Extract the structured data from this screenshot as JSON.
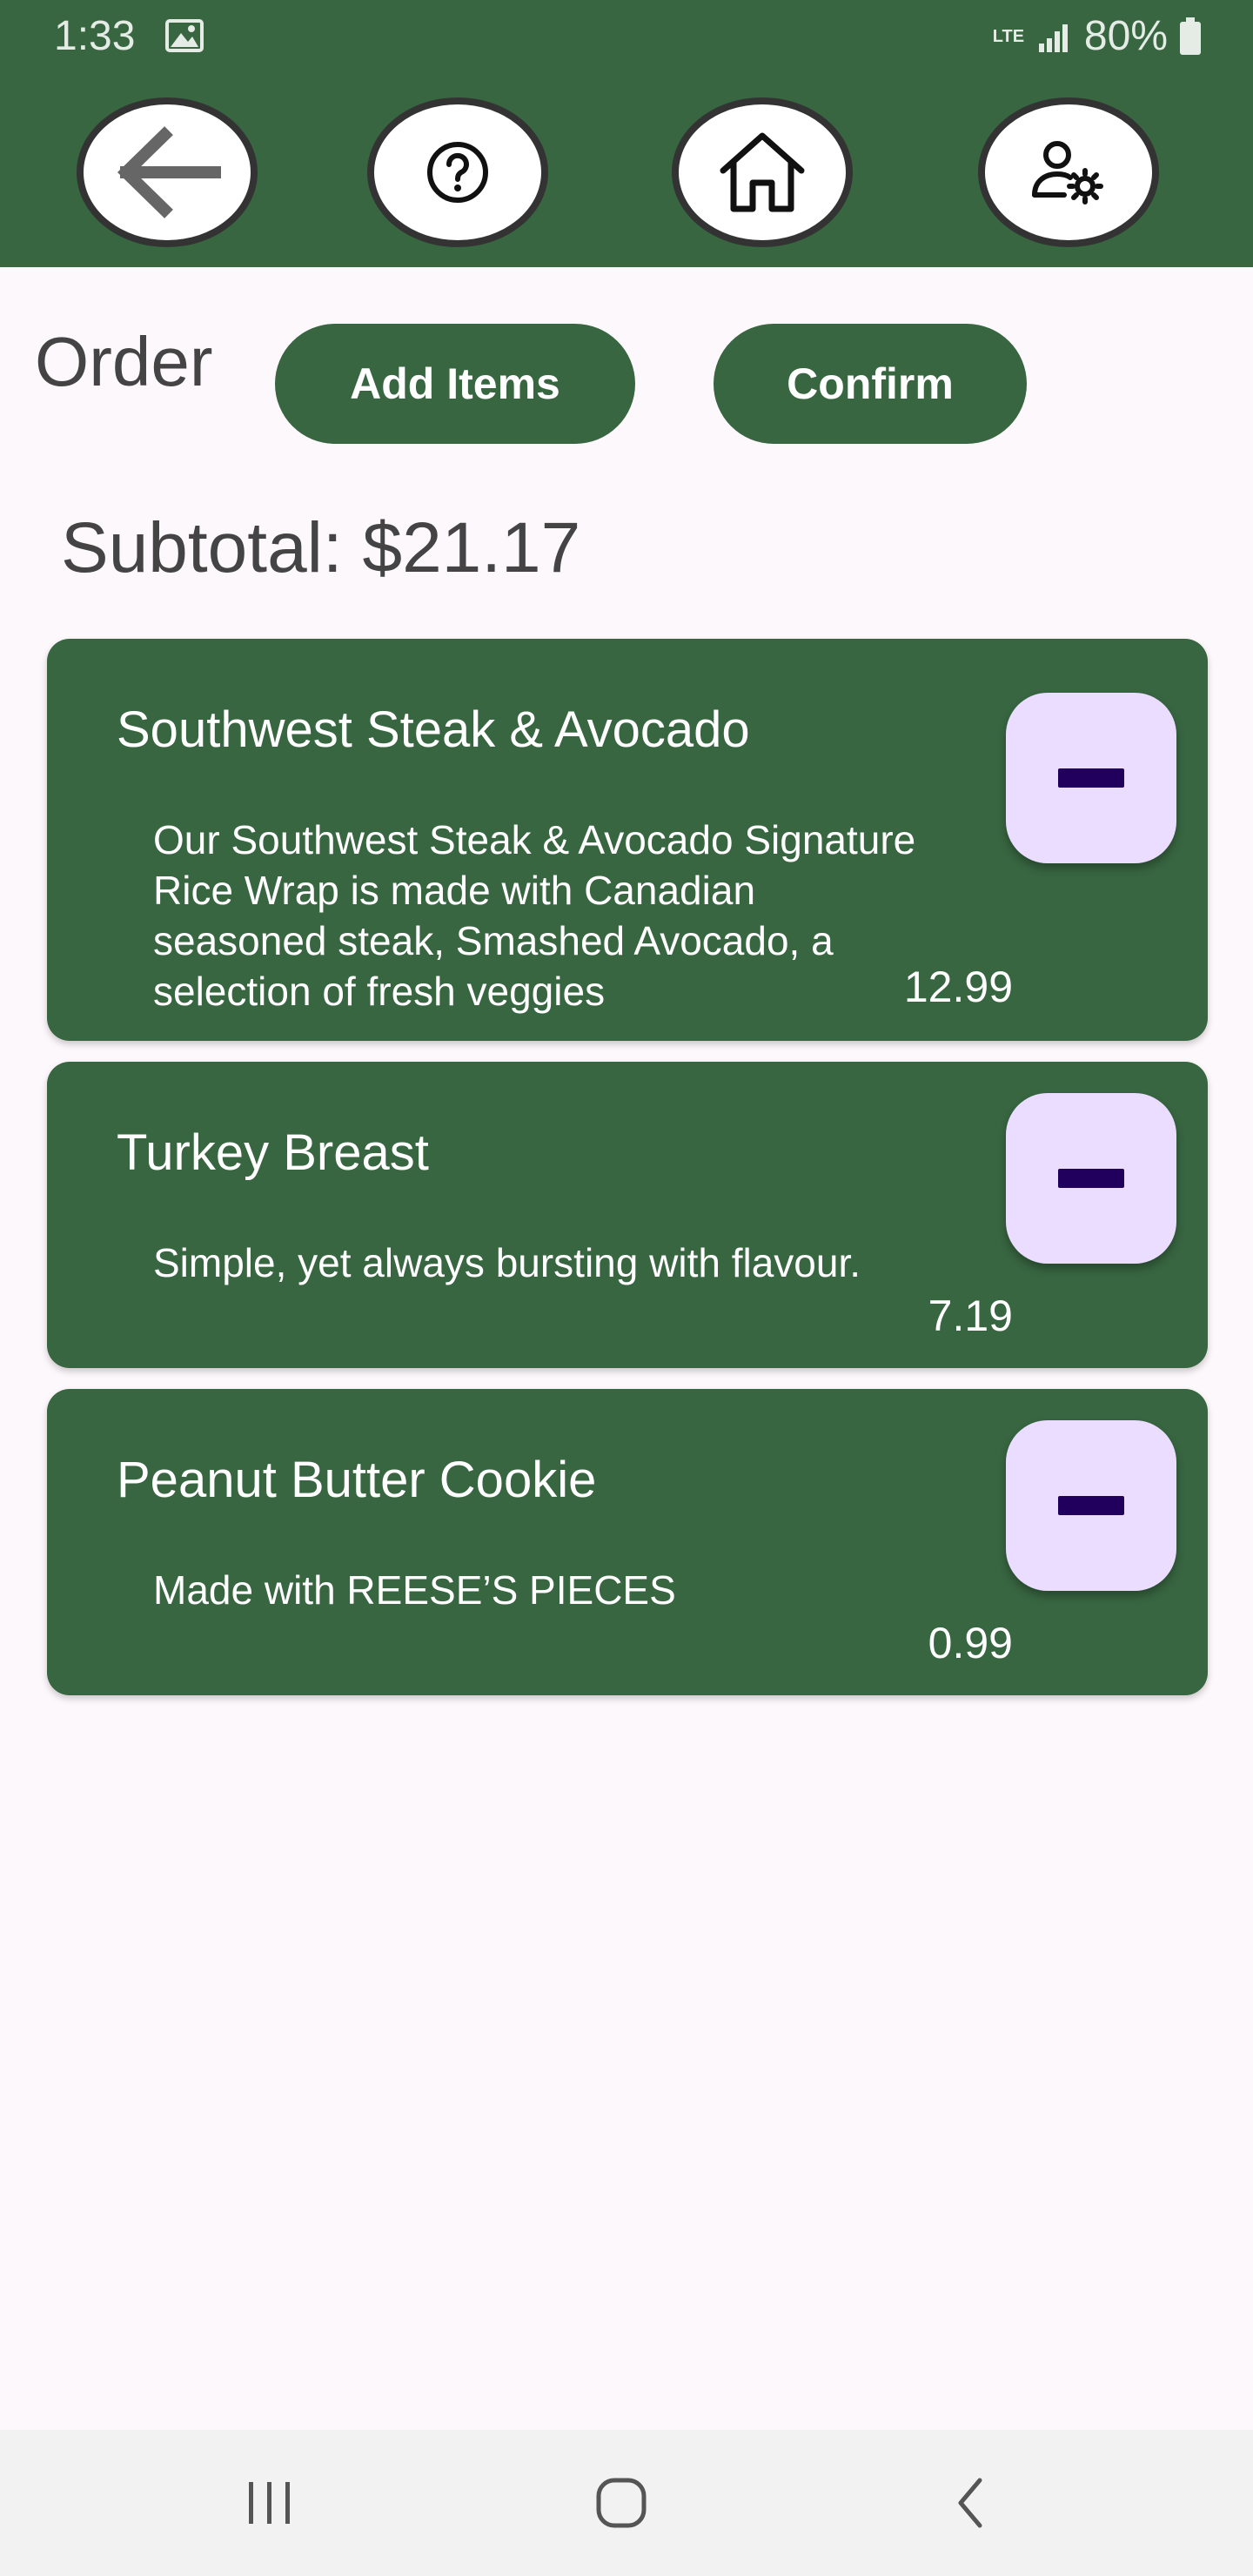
{
  "status_bar": {
    "time": "1:33",
    "network": "LTE",
    "battery": "80%",
    "icons": [
      "image-icon",
      "signal-icon",
      "battery-icon"
    ]
  },
  "header": {
    "buttons": [
      {
        "name": "back-button",
        "icon": "arrow-left-icon"
      },
      {
        "name": "help-button",
        "icon": "question-circle-icon"
      },
      {
        "name": "home-button",
        "icon": "home-icon"
      },
      {
        "name": "user-settings-button",
        "icon": "user-gear-icon"
      }
    ]
  },
  "order": {
    "title": "Order",
    "add_items_label": "Add Items",
    "confirm_label": "Confirm",
    "subtotal": "Subtotal: $21.17"
  },
  "items": [
    {
      "name": "Southwest Steak & Avocado",
      "description": "Our Southwest Steak & Avocado Signature Rice Wrap is made with Canadian seasoned steak, Smashed Avocado, a selection of fresh veggies",
      "price": "12.99"
    },
    {
      "name": "Turkey Breast",
      "description": "Simple, yet always bursting with flavour.",
      "price": "7.19"
    },
    {
      "name": "Peanut Butter Cookie",
      "description": "Made with REESE’S PIECES",
      "price": "0.99"
    }
  ],
  "colors": {
    "primary": "#386641",
    "background": "#FDF8FC",
    "remove_button": "#EADDFF",
    "remove_icon": "#21005D"
  },
  "bottom_nav": {
    "buttons": [
      "recent-apps-icon",
      "home-circle-icon",
      "back-chevron-icon"
    ]
  }
}
